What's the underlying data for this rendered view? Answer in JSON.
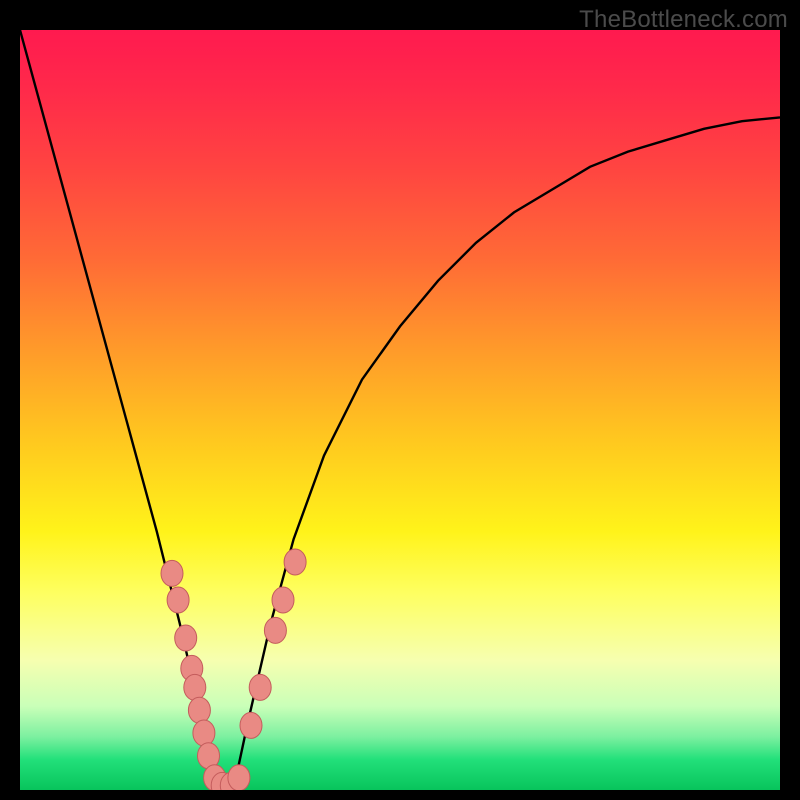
{
  "watermark": "TheBottleneck.com",
  "colors": {
    "background": "#000000",
    "curve": "#000000",
    "marker_fill": "#e98a84",
    "marker_stroke": "#c45c5c"
  },
  "chart_data": {
    "type": "line",
    "title": "",
    "xlabel": "",
    "ylabel": "",
    "xlim": [
      0,
      100
    ],
    "ylim": [
      0,
      100
    ],
    "grid": false,
    "legend": false,
    "note": "V-shaped bottleneck curve; minimum near x≈27; values read off plot area (0 bottom, 100 top)",
    "series": [
      {
        "name": "curve",
        "x": [
          0,
          3,
          6,
          9,
          12,
          15,
          18,
          21,
          24,
          25.5,
          27,
          28.5,
          30,
          33,
          36,
          40,
          45,
          50,
          55,
          60,
          65,
          70,
          75,
          80,
          85,
          90,
          95,
          100
        ],
        "y": [
          100,
          89,
          78,
          67,
          56,
          45,
          34,
          22,
          9,
          2,
          0,
          2,
          9,
          22,
          33,
          44,
          54,
          61,
          67,
          72,
          76,
          79,
          82,
          84,
          85.5,
          87,
          88,
          88.5
        ]
      }
    ],
    "markers": {
      "note": "salmon oval markers clustered near the curve minimum",
      "points": [
        {
          "x": 20.0,
          "y": 28.5
        },
        {
          "x": 20.8,
          "y": 25.0
        },
        {
          "x": 21.8,
          "y": 20.0
        },
        {
          "x": 22.6,
          "y": 16.0
        },
        {
          "x": 23.0,
          "y": 13.5
        },
        {
          "x": 23.6,
          "y": 10.5
        },
        {
          "x": 24.2,
          "y": 7.5
        },
        {
          "x": 24.8,
          "y": 4.5
        },
        {
          "x": 25.6,
          "y": 1.6
        },
        {
          "x": 26.6,
          "y": 0.6
        },
        {
          "x": 27.8,
          "y": 0.6
        },
        {
          "x": 28.8,
          "y": 1.6
        },
        {
          "x": 30.4,
          "y": 8.5
        },
        {
          "x": 31.6,
          "y": 13.5
        },
        {
          "x": 33.6,
          "y": 21.0
        },
        {
          "x": 34.6,
          "y": 25.0
        },
        {
          "x": 36.2,
          "y": 30.0
        }
      ]
    }
  }
}
